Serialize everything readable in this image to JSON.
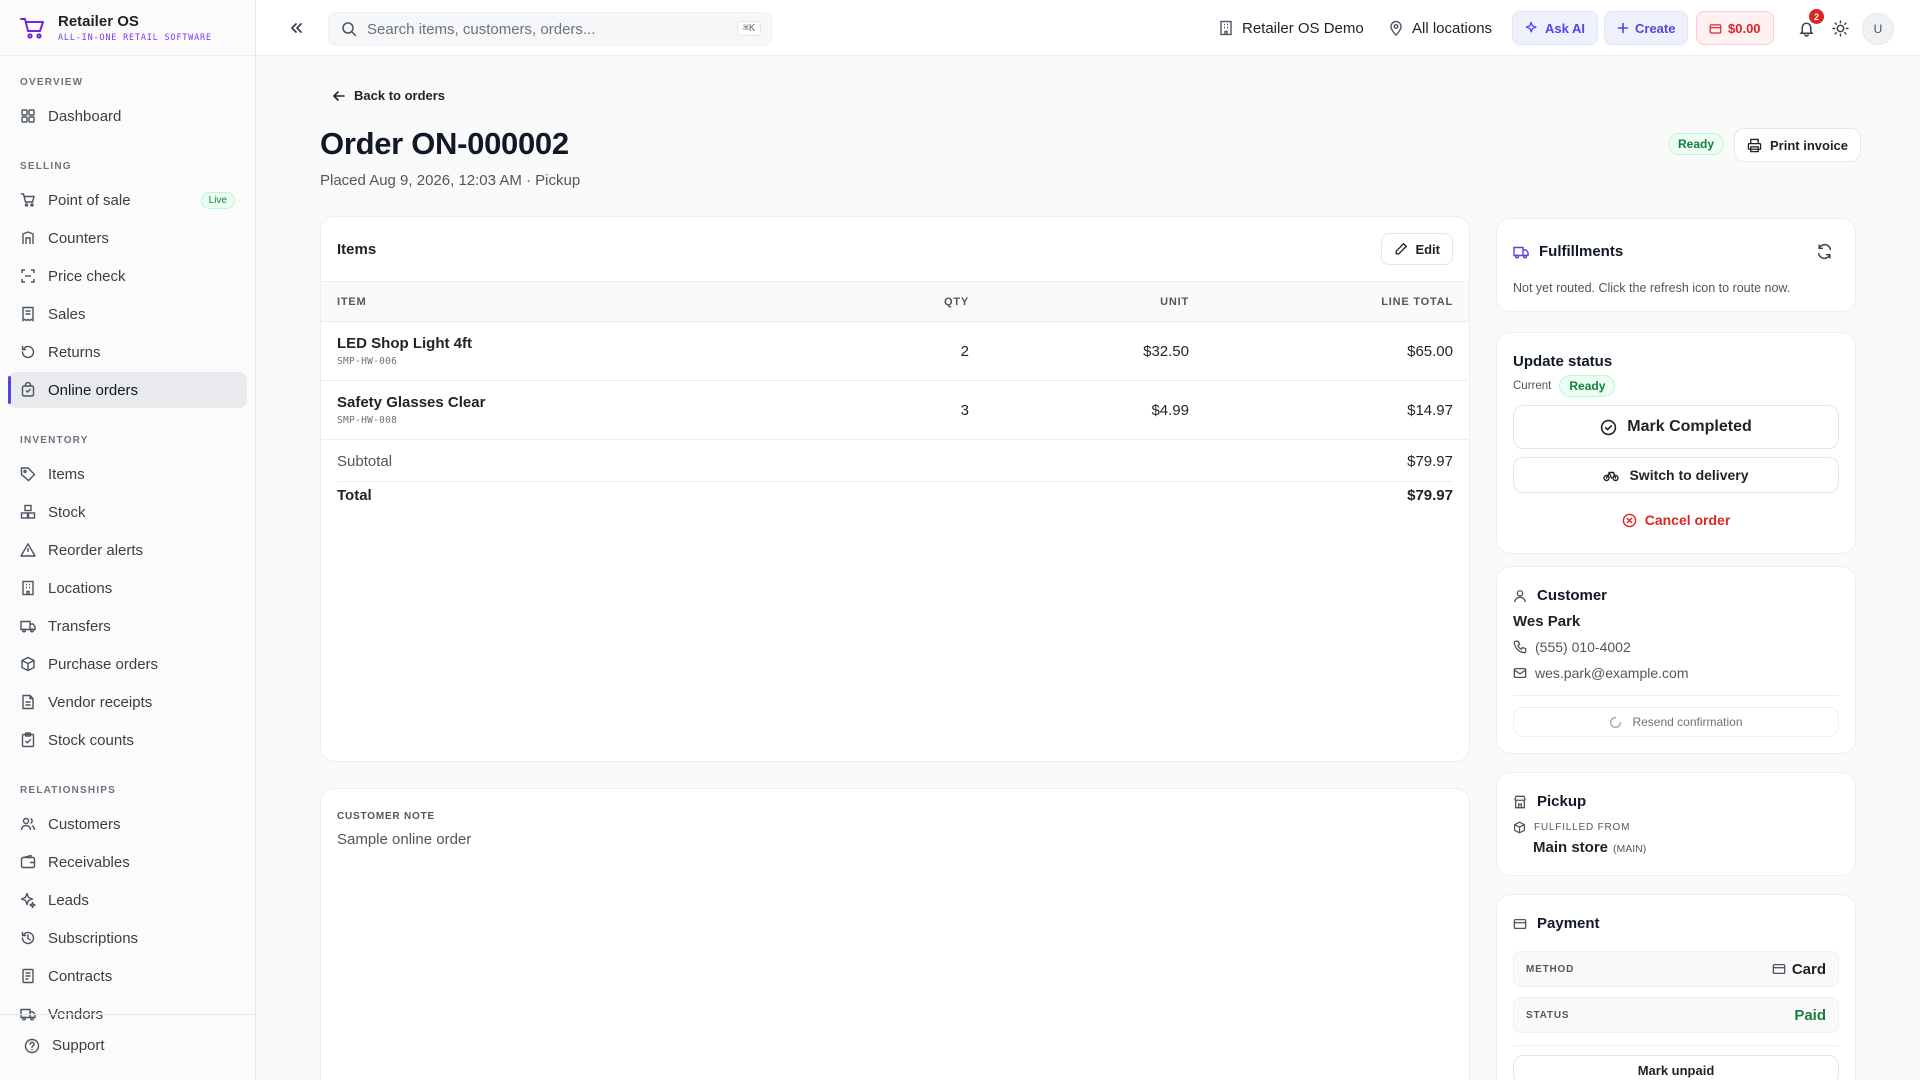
{
  "brand": {
    "name": "Retailer OS",
    "tagline": "ALL-IN-ONE RETAIL SOFTWARE"
  },
  "sidebar": {
    "sections": [
      {
        "title": "OVERVIEW",
        "items": [
          {
            "label": "Dashboard",
            "icon": "grid-icon"
          }
        ]
      },
      {
        "title": "SELLING",
        "items": [
          {
            "label": "Point of sale",
            "icon": "cart-icon",
            "badge": "Live"
          },
          {
            "label": "Counters",
            "icon": "counter-icon"
          },
          {
            "label": "Price check",
            "icon": "scan-icon"
          },
          {
            "label": "Sales",
            "icon": "receipt-icon"
          },
          {
            "label": "Returns",
            "icon": "return-icon"
          },
          {
            "label": "Online orders",
            "icon": "bag-icon",
            "active": true
          }
        ]
      },
      {
        "title": "INVENTORY",
        "items": [
          {
            "label": "Items",
            "icon": "tag-icon"
          },
          {
            "label": "Stock",
            "icon": "boxes-icon"
          },
          {
            "label": "Reorder alerts",
            "icon": "alert-icon"
          },
          {
            "label": "Locations",
            "icon": "building-icon"
          },
          {
            "label": "Transfers",
            "icon": "truck-icon"
          },
          {
            "label": "Purchase orders",
            "icon": "package-icon"
          },
          {
            "label": "Vendor receipts",
            "icon": "file-icon"
          },
          {
            "label": "Stock counts",
            "icon": "clipboard-icon"
          }
        ]
      },
      {
        "title": "RELATIONSHIPS",
        "items": [
          {
            "label": "Customers",
            "icon": "users-icon"
          },
          {
            "label": "Receivables",
            "icon": "wallet-icon"
          },
          {
            "label": "Leads",
            "icon": "sparkle-icon"
          },
          {
            "label": "Subscriptions",
            "icon": "history-icon"
          },
          {
            "label": "Contracts",
            "icon": "document-icon"
          },
          {
            "label": "Vendors",
            "icon": "truck-icon"
          }
        ]
      }
    ],
    "support_label": "Support"
  },
  "header": {
    "search_placeholder": "Search items, customers, orders...",
    "search_shortcut": "⌘K",
    "store": "Retailer OS Demo",
    "location": "All locations",
    "ask_ai": "Ask AI",
    "create": "Create",
    "cash": "$0.00",
    "notifications": "2",
    "avatar": "U"
  },
  "order": {
    "back": "Back to orders",
    "title": "Order ON-000002",
    "subtitle": "Placed Aug 9, 2026, 12:03 AM · Pickup",
    "status": "Ready",
    "print": "Print invoice",
    "items_title": "Items",
    "edit": "Edit",
    "columns": {
      "item": "ITEM",
      "qty": "QTY",
      "unit": "UNIT",
      "total": "LINE TOTAL"
    },
    "lines": [
      {
        "name": "LED Shop Light 4ft",
        "sku": "SMP-HW-006",
        "qty": "2",
        "unit": "$32.50",
        "total": "$65.00"
      },
      {
        "name": "Safety Glasses Clear",
        "sku": "SMP-HW-008",
        "qty": "3",
        "unit": "$4.99",
        "total": "$14.97"
      }
    ],
    "subtotal_label": "Subtotal",
    "subtotal": "$79.97",
    "total_label": "Total",
    "total": "$79.97",
    "note_label": "CUSTOMER NOTE",
    "note": "Sample online order"
  },
  "fulfillments": {
    "title": "Fulfillments",
    "text": "Not yet routed. Click the refresh icon to route now."
  },
  "update_status": {
    "title": "Update status",
    "current_label": "Current",
    "current": "Ready",
    "mark_completed": "Mark Completed",
    "switch_delivery": "Switch to delivery",
    "cancel": "Cancel order"
  },
  "customer": {
    "title": "Customer",
    "name": "Wes Park",
    "phone": "(555) 010-4002",
    "email": "wes.park@example.com",
    "resend": "Resend confirmation"
  },
  "pickup": {
    "title": "Pickup",
    "from_label": "FULFILLED FROM",
    "store": "Main store",
    "store_code": "(MAIN)"
  },
  "payment": {
    "title": "Payment",
    "method_label": "METHOD",
    "method": "Card",
    "status_label": "STATUS",
    "status": "Paid",
    "mark_unpaid": "Mark unpaid"
  },
  "colors": {
    "accent": "#4f46e5",
    "success": "#15803d",
    "danger": "#dc2626"
  }
}
